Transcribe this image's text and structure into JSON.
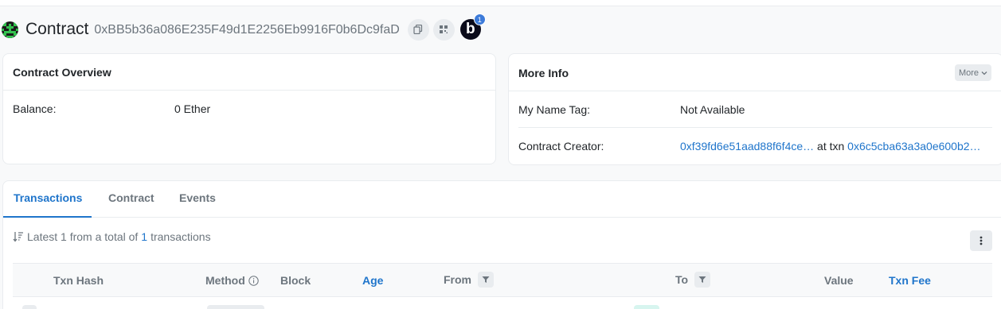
{
  "header": {
    "title": "Contract",
    "address": "0xBB5b36a086E235F49d1E2256Eb9916F0b6Dc9faD",
    "blockscan_letter": "b",
    "blockscan_badge": "1"
  },
  "overview": {
    "title": "Contract Overview",
    "balance_label": "Balance:",
    "balance_value": "0 Ether"
  },
  "more_info": {
    "title": "More Info",
    "more_button": "More",
    "name_tag_label": "My Name Tag:",
    "name_tag_value": "Not Available",
    "creator_label": "Contract Creator:",
    "creator_address": "0xf39fd6e51aad88f6f4ce…",
    "at_txn_text": "at txn",
    "creator_txn": "0x6c5cba63a3a0e600b2…"
  },
  "tabs": {
    "transactions": "Transactions",
    "contract": "Contract",
    "events": "Events"
  },
  "summary": {
    "prefix": "Latest 1 from a total of",
    "count": "1",
    "suffix": "transactions"
  },
  "table": {
    "columns": {
      "txn_hash": "Txn Hash",
      "method": "Method",
      "block": "Block",
      "age": "Age",
      "from": "From",
      "to": "To",
      "value": "Value",
      "txn_fee": "Txn Fee"
    }
  },
  "icons": {
    "copy": "copy-icon",
    "qr": "qr-code-icon",
    "blockscan": "blockscan-icon",
    "sort": "sort-icon",
    "kebab": "more-vertical-icon",
    "filter": "filter-icon",
    "info": "info-icon",
    "chevron": "chevron-down-icon"
  },
  "colors": {
    "accent": "#1f75cb",
    "muted": "#6c757d",
    "border": "#e9ecef"
  }
}
